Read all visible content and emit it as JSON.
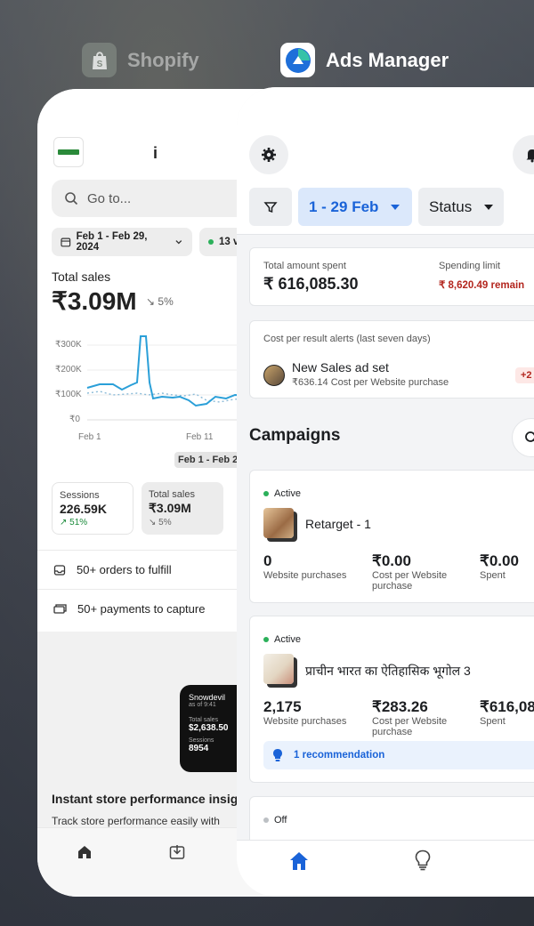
{
  "switcher": {
    "shopify_label": "Shopify",
    "ads_label": "Ads Manager"
  },
  "shopify": {
    "store_name_partial": "i",
    "search_placeholder": "Go to...",
    "date_chip": "Feb 1 - Feb 29, 2024",
    "visitors_chip": "13 v",
    "total_sales_label": "Total sales",
    "total_sales_value": "₹3.09M",
    "total_sales_change": "5%",
    "chart_yticks": [
      "₹300K",
      "₹200K",
      "₹100K",
      "₹0"
    ],
    "chart_xticks": [
      "Feb 1",
      "Feb 11"
    ],
    "date_pill": "Feb 1 - Feb 2",
    "metrics": [
      {
        "label": "Sessions",
        "value": "226.59K",
        "change": "51%"
      },
      {
        "label": "Total sales",
        "value": "₹3.09M",
        "change": "5%"
      }
    ],
    "rows": [
      {
        "label": "50+ orders to fulfill",
        "icon": "inbox-icon"
      },
      {
        "label": "50+ payments to capture",
        "icon": "cash-icon"
      }
    ],
    "widget": {
      "store": "Snowdevil",
      "asof": "as of 9:41",
      "sales_label": "Total sales",
      "sales_value": "$2,638.50",
      "sessions_label": "Sessions",
      "sessions_value": "8954"
    },
    "insight_title": "Instant store performance insig",
    "insight_sub": "Track store performance easily with"
  },
  "ads": {
    "date_filter": "1 - 29 Feb",
    "status_filter": "Status",
    "total_spent_label": "Total amount spent",
    "total_spent_value": "₹ 616,085.30",
    "spending_limit_label": "Spending limit",
    "spending_limit_value": "₹ 8,620.49 remain",
    "alerts_label": "Cost per result alerts (last seven days)",
    "alert_name": "New Sales ad set",
    "alert_detail": "₹636.14  Cost per Website purchase",
    "alert_badge": "+2",
    "campaigns_title": "Campaigns",
    "campaigns": [
      {
        "status": "Active",
        "name": "Retarget - 1",
        "purchases": "0",
        "purchases_label": "Website purchases",
        "cost": "₹0.00",
        "cost_label_1": "Cost per Website",
        "cost_label_2": "purchase",
        "spent": "₹0.00",
        "spent_label": "Spent"
      },
      {
        "status": "Active",
        "name": "प्राचीन भारत का ऐतिहासिक भूगोल 3",
        "purchases": "2,175",
        "purchases_label": "Website purchases",
        "cost": "₹283.26",
        "cost_label_1": "Cost per Website",
        "cost_label_2": "purchase",
        "spent": "₹616,08",
        "spent_label": "Spent",
        "recommendation": "1 recommendation"
      },
      {
        "status": "Off"
      }
    ],
    "colors": {
      "accent": "#1a63d8",
      "active": "#2bb05a",
      "warning": "#b3261e"
    }
  }
}
